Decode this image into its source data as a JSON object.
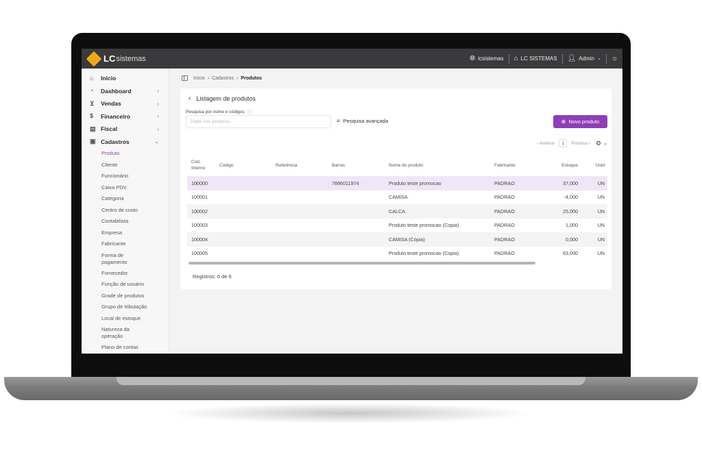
{
  "topbar": {
    "logo_lc": "LC",
    "logo_sis": "sistemas",
    "site_label": "lcsistemas",
    "company_label": "LC SISTEMAS",
    "user_label": "Admin"
  },
  "sidebar": {
    "items": [
      {
        "label": "Início",
        "icon": "home-icon"
      },
      {
        "label": "Dashboard",
        "icon": "chart-icon",
        "chevron": "›"
      },
      {
        "label": "Vendas",
        "icon": "cart-icon",
        "chevron": "›"
      },
      {
        "label": "Financeiro",
        "icon": "money-icon",
        "chevron": "›"
      },
      {
        "label": "Fiscal",
        "icon": "document-icon",
        "chevron": "›"
      },
      {
        "label": "Cadastros",
        "icon": "folder-icon",
        "chevron": "⌄"
      }
    ],
    "sub_items": [
      "Produto",
      "Cliente",
      "Funcionário",
      "Caixa PDV",
      "Categoria",
      "Centro de custo",
      "Contabilista",
      "Empresa",
      "Fabricante",
      "Forma de pagamento",
      "Fornecedor",
      "Função de usuário",
      "Grade de produtos",
      "Grupo de tributação",
      "Local de estoque",
      "Natureza da operação",
      "Plano de contas"
    ]
  },
  "breadcrumb": {
    "home": "Início",
    "section": "Cadastros",
    "current": "Produtos",
    "sep": "›"
  },
  "card": {
    "title": "Listagem de produtos",
    "search_label": "Pesquisa por nome e códigos",
    "search_placeholder": "Digite sua pesquisa...",
    "advanced_search": "Pesquisa avançada",
    "new_button": "Novo produto"
  },
  "pager": {
    "prev": "‹ Anterior",
    "page": "1",
    "next": "Próxima ›"
  },
  "table": {
    "headers": {
      "cod_interno_1": "Cód.",
      "cod_interno_2": "Interno",
      "codigo": "Código",
      "referencia": "Referência",
      "barras": "Barras",
      "nome": "Nome do produto",
      "fabricante": "Fabricante",
      "estoque": "Estoque",
      "unid": "Unid"
    },
    "rows": [
      {
        "cod": "100000",
        "codigo": "",
        "ref": "",
        "barras": "7896011974",
        "nome": "Produto teste promocao",
        "fab": "PADRAO",
        "estoque": "37,000",
        "unid": "UN"
      },
      {
        "cod": "100001",
        "codigo": "",
        "ref": "",
        "barras": "",
        "nome": "CAMISA",
        "fab": "PADRAO",
        "estoque": "-4,000",
        "unid": "UN"
      },
      {
        "cod": "100002",
        "codigo": "",
        "ref": "",
        "barras": "",
        "nome": "CALCA",
        "fab": "PADRAO",
        "estoque": "25,000",
        "unid": "UN"
      },
      {
        "cod": "100003",
        "codigo": "",
        "ref": "",
        "barras": "",
        "nome": "Produto teste promocao (Copia)",
        "fab": "PADRAO",
        "estoque": "1,000",
        "unid": "UN"
      },
      {
        "cod": "100004",
        "codigo": "",
        "ref": "",
        "barras": "",
        "nome": "CAMISA (Cópia)",
        "fab": "PADRAO",
        "estoque": "0,000",
        "unid": "UN"
      },
      {
        "cod": "100005",
        "codigo": "",
        "ref": "",
        "barras": "",
        "nome": "Produto teste promocao (Copia)",
        "fab": "PADRAO",
        "estoque": "63,000",
        "unid": "UN"
      }
    ]
  },
  "records": "Registros: 6 de 6",
  "colors": {
    "accent": "#8e3fb6",
    "highlight_row": "#f1e6f7",
    "topbar": "#3a3a3c"
  }
}
